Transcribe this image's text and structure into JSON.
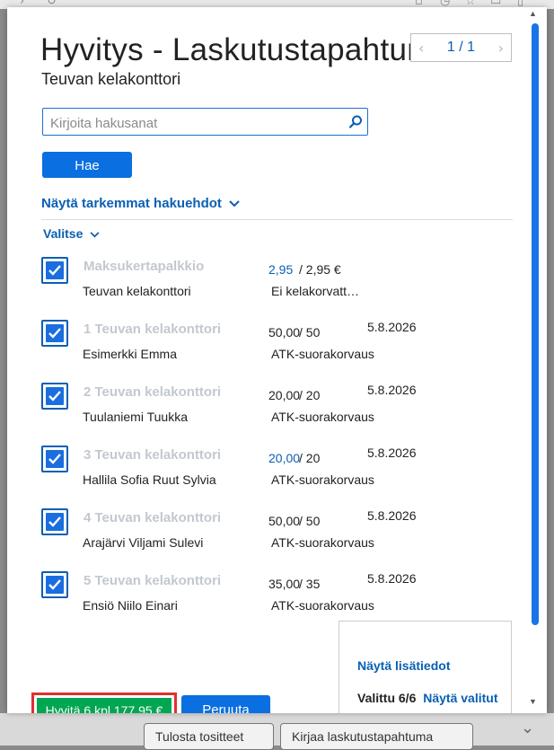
{
  "background": {
    "bottom_buttons": [
      "Tulosta tositteet",
      "Kirjaa laskutustapahtuma"
    ]
  },
  "dialog": {
    "title": "Hyvitys - Laskutustapahtumat",
    "subtitle": "Teuvan kelakonttori",
    "pager": {
      "text": "1 / 1"
    },
    "search": {
      "placeholder": "Kirjoita hakusanat",
      "value": ""
    },
    "search_button": "Hae",
    "advanced_link": "Näytä tarkemmat hakuehdot",
    "select_menu": "Valitse",
    "rows": [
      {
        "checked": true,
        "title": "Maksukertapalkkio",
        "name": "Teuvan kelakonttori",
        "amount": "2,95",
        "separator": " / ",
        "amount2": "2,95 €",
        "date": "",
        "method": "Ei kelakorvatt…",
        "amount_blue": true
      },
      {
        "checked": true,
        "title": "1 Teuvan kelakonttori",
        "name": "Esimerkki Emma",
        "amount": "50,00",
        "separator": " / ",
        "amount2": "50",
        "date": "5.8.2026",
        "method": "ATK-suorakorvaus",
        "amount_blue": false
      },
      {
        "checked": true,
        "title": "2 Teuvan kelakonttori",
        "name": "Tuulaniemi Tuukka",
        "amount": "20,00",
        "separator": " / ",
        "amount2": "20",
        "date": "5.8.2026",
        "method": "ATK-suorakorvaus",
        "amount_blue": false
      },
      {
        "checked": true,
        "title": "3 Teuvan kelakonttori",
        "name": "Hallila Sofia Ruut Sylvia",
        "amount": "20,00",
        "separator": " / ",
        "amount2": "20",
        "date": "5.8.2026",
        "method": "ATK-suorakorvaus",
        "amount_blue": true
      },
      {
        "checked": true,
        "title": "4 Teuvan kelakonttori",
        "name": "Arajärvi Viljami Sulevi",
        "amount": "50,00",
        "separator": " / ",
        "amount2": "50",
        "date": "5.8.2026",
        "method": "ATK-suorakorvaus",
        "amount_blue": false
      },
      {
        "checked": true,
        "title": "5 Teuvan kelakonttori",
        "name": "Ensiö Niilo Einari",
        "amount": "35,00",
        "separator": " / ",
        "amount2": "35",
        "date": "5.8.2026",
        "method": "ATK-suorakorvaus",
        "amount_blue": false
      }
    ],
    "info": {
      "more_link": "Näytä lisätiedot",
      "selected": "Valittu 6/6",
      "show_selected": "Näytä valitut"
    },
    "credit_button": "Hyvitä 6 kpl 177,95 €",
    "cancel_button": "Peruuta",
    "colors": {
      "accent": "#0a6fe0",
      "credit": "#00a651",
      "highlight": "#e0302f"
    }
  }
}
